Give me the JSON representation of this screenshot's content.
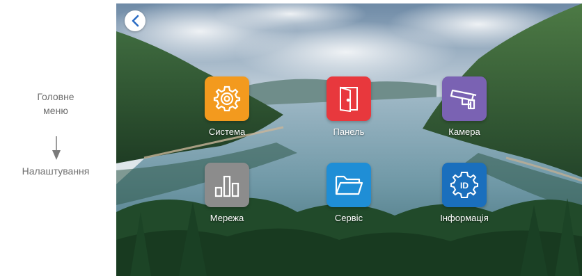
{
  "annotation": {
    "top_line1": "Головне",
    "top_line2": "меню",
    "bottom": "Налаштування"
  },
  "screen": {
    "back_label": "back",
    "tiles": [
      {
        "label": "Система",
        "icon": "gear-icon",
        "color": "#f39a1e"
      },
      {
        "label": "Панель",
        "icon": "door-icon",
        "color": "#e8383d"
      },
      {
        "label": "Камера",
        "icon": "cctv-camera-icon",
        "color": "#7a62b3"
      },
      {
        "label": "Мережа",
        "icon": "bar-chart-icon",
        "color": "#8c8c8c"
      },
      {
        "label": "Сервіс",
        "icon": "folder-icon",
        "color": "#1f8ed6"
      },
      {
        "label": "Інформація",
        "icon": "id-gear-icon",
        "color": "#1a6fbd"
      }
    ]
  }
}
